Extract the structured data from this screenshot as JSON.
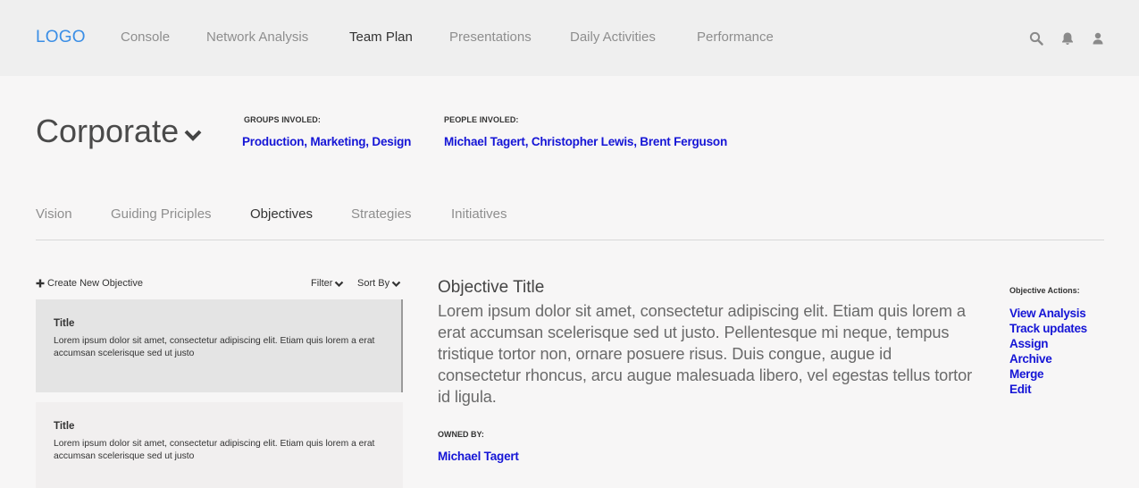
{
  "navbar": {
    "logo": "LOGO",
    "links": [
      "Console",
      "Network Analysis",
      "Team Plan",
      "Presentations",
      "Daily Activities",
      "Performance"
    ],
    "active": "Team Plan",
    "icons": [
      "search-icon",
      "bell-icon",
      "user-icon"
    ]
  },
  "header": {
    "org_title": "Corporate",
    "groups_label": "GROUPS  INVOLED:",
    "groups_value": "Production, Marketing, Design",
    "people_label": "PEOPLE INVOLED:",
    "people_value": "Michael Tagert, Christopher Lewis, Brent Ferguson"
  },
  "tabs": {
    "items": [
      "Vision",
      "Guiding Priciples",
      "Objectives",
      "Strategies",
      "Initiatives"
    ],
    "active": "Objectives"
  },
  "list": {
    "create_label": "Create New Objective",
    "filter_label": "Filter",
    "sort_label": "Sort By",
    "cards": [
      {
        "title": "Title",
        "body": "Lorem ipsum dolor sit amet, consectetur adipiscing elit. Etiam quis lorem a erat accumsan scelerisque sed ut justo",
        "selected": true
      },
      {
        "title": "Title",
        "body": "Lorem ipsum dolor sit amet, consectetur adipiscing elit. Etiam quis lorem a erat accumsan scelerisque sed ut justo",
        "selected": false
      }
    ]
  },
  "detail": {
    "title": "Objective Title",
    "body": "Lorem ipsum dolor sit amet, consectetur adipiscing elit. Etiam quis lorem a erat accumsan scelerisque sed ut justo. Pellentesque mi neque, tempus tristique tortor non, ornare posuere risus. Duis congue, augue id consectetur rhoncus, arcu augue malesuada libero, vel egestas tellus tortor id ligula.",
    "owned_label": "OWNED BY:",
    "owned_value": "Michael Tagert"
  },
  "actions": {
    "label": "Objective Actions:",
    "items": [
      "View Analysis",
      "Track updates",
      "Assign",
      "Archive",
      "Merge",
      "Edit"
    ]
  },
  "colors": {
    "accent_link": "#1515d6",
    "logo": "#3a8ee6",
    "navbar_bg": "#efefef",
    "page_bg": "#f7f6f6"
  }
}
